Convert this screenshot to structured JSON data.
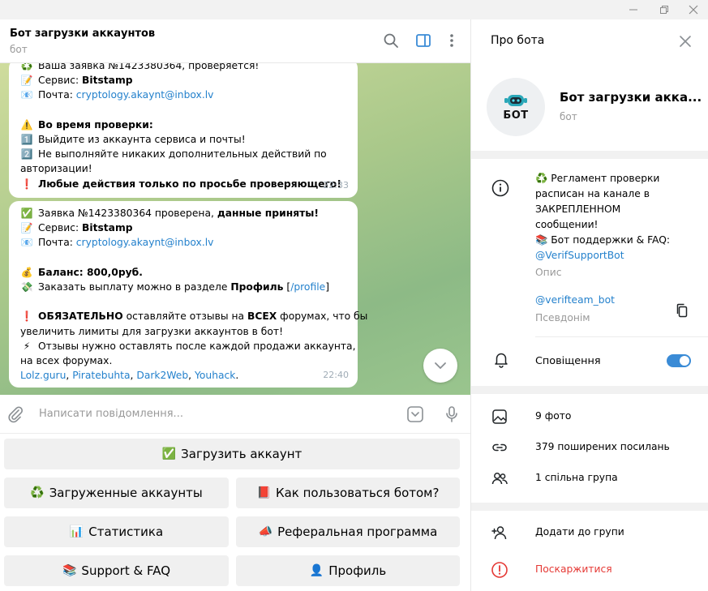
{
  "window": {
    "minimize": "—",
    "maximize": "❐",
    "close": "✕"
  },
  "chat": {
    "title": "Бот загрузки аккаунтов",
    "subtitle": "бот",
    "messages": [
      {
        "time": "22:33",
        "lines": [
          {
            "emoji": "♻️",
            "pre": "Ваша заявка №1423380364, проверяется!"
          },
          {
            "emoji": "📝",
            "pre": "Сервис: ",
            "bold": "Bitstamp"
          },
          {
            "emoji": "📧",
            "pre": "Почта: ",
            "link": "cryptology.akaynt@inbox.lv"
          },
          {
            "gap": true
          },
          {
            "emoji": "⚠️",
            "bold": "Во время проверки:"
          },
          {
            "emoji": "1️⃣",
            "pre": "Выйдите из аккаунта сервиса и почты!"
          },
          {
            "emoji": "2️⃣",
            "pre": "Не выполняйте никаких дополнительных действий по"
          },
          {
            "pre": "авторизации!"
          },
          {
            "emoji": "❗",
            "bold": "Любые действия только по просьбе проверяющего!"
          }
        ]
      },
      {
        "time": "22:40",
        "lines": [
          {
            "emoji": "✅",
            "pre": "Заявка №1423380364 проверена, ",
            "bold": "данные приняты!"
          },
          {
            "emoji": "📝",
            "pre": "Сервис: ",
            "bold": "Bitstamp"
          },
          {
            "emoji": "📧",
            "pre": "Почта: ",
            "link": "cryptology.akaynt@inbox.lv"
          },
          {
            "gap": true
          },
          {
            "emoji": "💰",
            "bold": "Баланс: 800,0руб."
          },
          {
            "emoji": "💸",
            "pre": "Заказать выплату можно в разделе ",
            "bold": "Профиль",
            "post": " [",
            "link": "/profile",
            "post2": "]"
          },
          {
            "gap": true
          },
          {
            "emoji": "❗",
            "bold": "ОБЯЗАТЕЛЬНО",
            "post": " оставляйте отзывы на ",
            "bold2": "ВСЕХ",
            "post2": " форумах, что бы"
          },
          {
            "pre": "увеличить лимиты для загрузки аккаунтов в бот!"
          },
          {
            "emoji": "⚡",
            "pre": "Отзывы нужно оставлять после каждой продажи аккаунта,"
          },
          {
            "pre": "на всех форумах."
          },
          {
            "links": [
              "Lolz.guru",
              "Piratebuhta",
              "Dark2Web",
              "Youhack"
            ],
            "end": "."
          }
        ]
      }
    ],
    "input_placeholder": "Написати повідомлення..."
  },
  "keyboard": {
    "rows": [
      [
        {
          "emoji": "✅",
          "label": "Загрузить аккаунт"
        }
      ],
      [
        {
          "emoji": "♻️",
          "label": "Загруженные аккаунты"
        },
        {
          "emoji": "📕",
          "label": "Как пользоваться ботом?"
        }
      ],
      [
        {
          "emoji": "📊",
          "label": "Статистика"
        },
        {
          "emoji": "📣",
          "label": "Реферальная программа"
        }
      ],
      [
        {
          "emoji": "📚",
          "label": "Support & FAQ"
        },
        {
          "emoji": "👤",
          "label": "Профиль"
        }
      ]
    ]
  },
  "panel": {
    "title": "Про бота",
    "avatar_text": "БОТ",
    "name": "Бот загрузки акка...",
    "subtitle": "бот",
    "description_lines": [
      "♻️ Регламент проверки",
      "расписан на канале в",
      "ЗАКРЕПЛЕННОМ",
      "сообщении!",
      "📚 Бот поддержки & FAQ:"
    ],
    "description_link": "@VerifSupportBot",
    "description_label": "Опис",
    "username": "@verifteam_bot",
    "username_label": "Псевдонім",
    "notifications_label": "Сповіщення",
    "notifications_on": true,
    "media": [
      {
        "icon": "photo-icon",
        "label": "9 фото"
      },
      {
        "icon": "link-icon",
        "label": "379 поширених посилань"
      },
      {
        "icon": "group-icon",
        "label": "1 спільна група"
      }
    ],
    "actions": [
      {
        "icon": "add-user-icon",
        "label": "Додати до групи",
        "danger": false
      },
      {
        "icon": "report-icon",
        "label": "Поскаржитися",
        "danger": true
      }
    ],
    "colors": {
      "accent": "#2481cc",
      "toggle": "#3a8bd6",
      "danger": "#e53935"
    }
  }
}
